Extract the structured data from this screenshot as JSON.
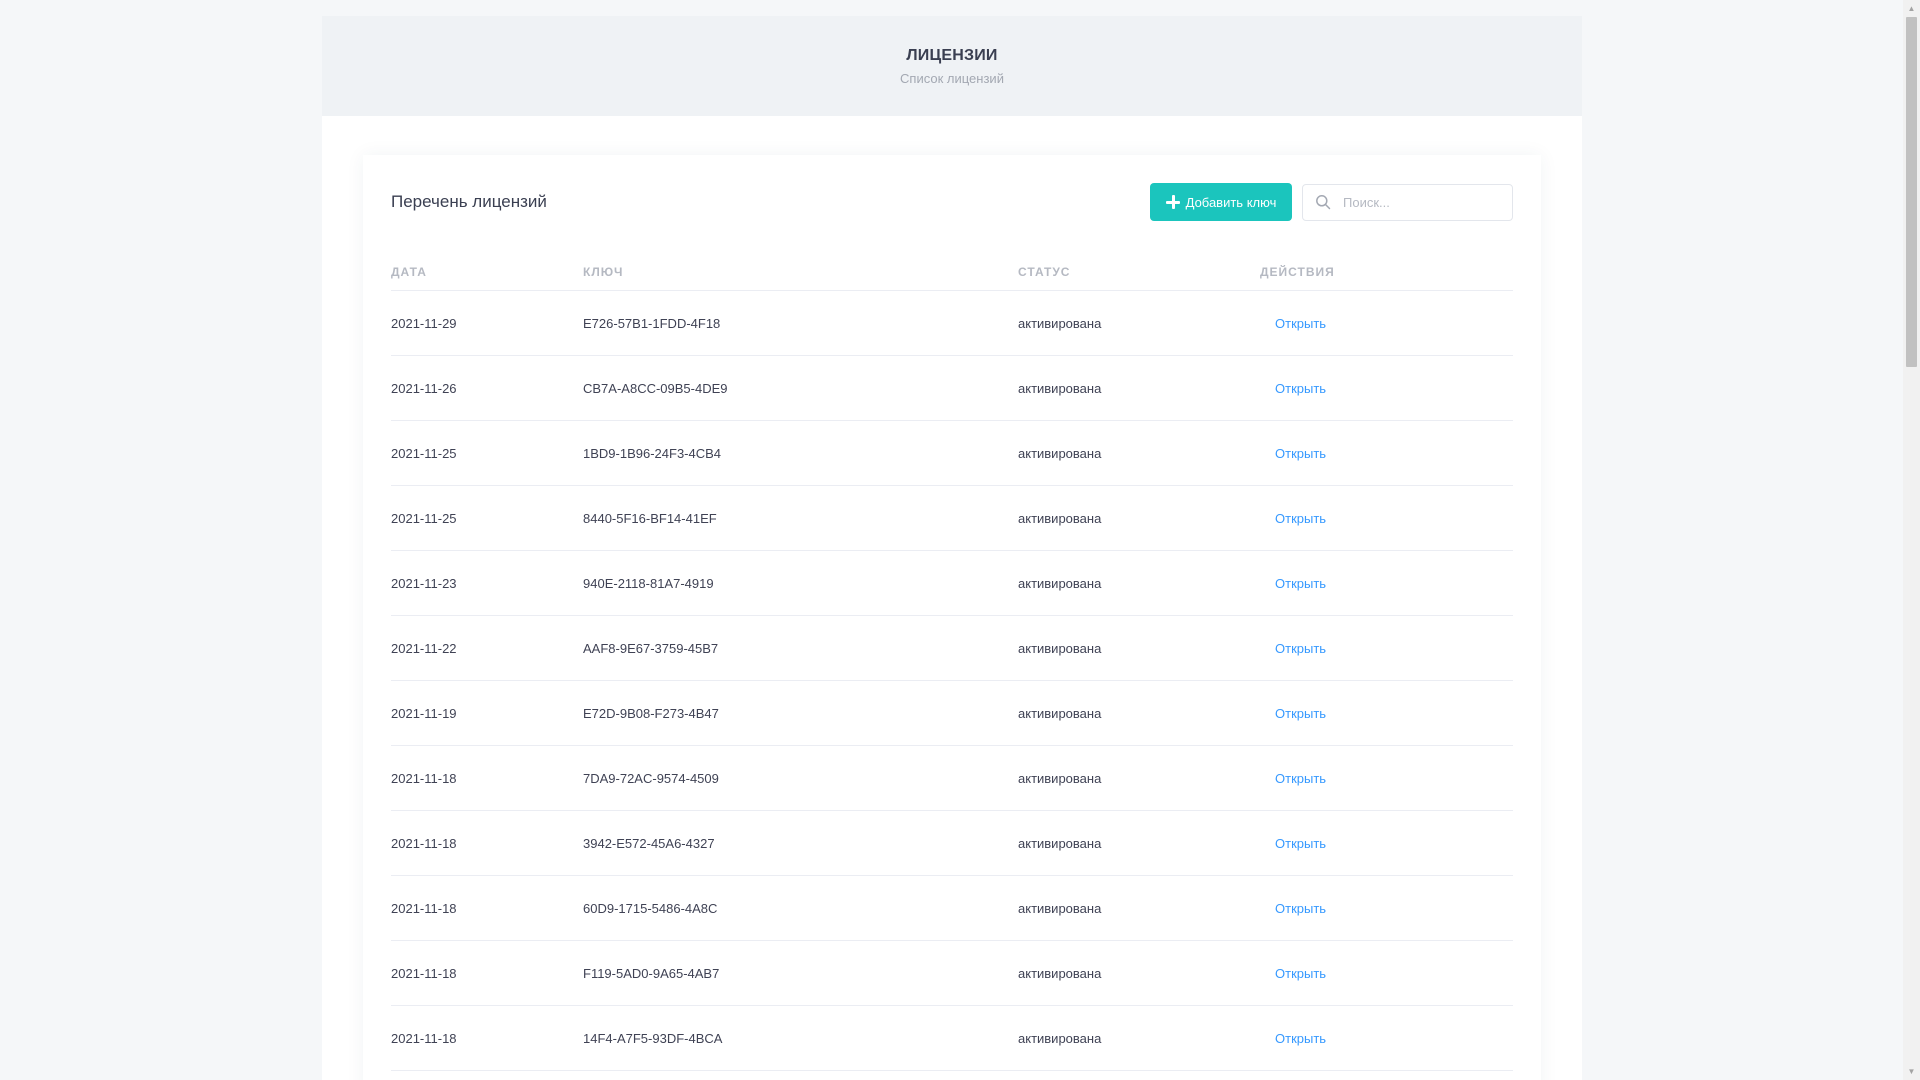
{
  "header": {
    "title": "ЛИЦЕНЗИИ",
    "subtitle": "Список лицензий"
  },
  "card": {
    "title": "Перечень лицензий",
    "add_button_label": "Добавить ключ",
    "search_placeholder": "Поиск..."
  },
  "table": {
    "columns": [
      "ДАТА",
      "КЛЮЧ",
      "СТАТУС",
      "ДЕЙСТВИЯ"
    ],
    "rows": [
      {
        "date": "2021-11-29",
        "key": "E726-57B1-1FDD-4F18",
        "status": "активирована",
        "action": "Открыть"
      },
      {
        "date": "2021-11-26",
        "key": "CB7A-A8CC-09B5-4DE9",
        "status": "активирована",
        "action": "Открыть"
      },
      {
        "date": "2021-11-25",
        "key": "1BD9-1B96-24F3-4CB4",
        "status": "активирована",
        "action": "Открыть"
      },
      {
        "date": "2021-11-25",
        "key": "8440-5F16-BF14-41EF",
        "status": "активирована",
        "action": "Открыть"
      },
      {
        "date": "2021-11-23",
        "key": "940E-2118-81A7-4919",
        "status": "активирована",
        "action": "Открыть"
      },
      {
        "date": "2021-11-22",
        "key": "AAF8-9E67-3759-45B7",
        "status": "активирована",
        "action": "Открыть"
      },
      {
        "date": "2021-11-19",
        "key": "E72D-9B08-F273-4B47",
        "status": "активирована",
        "action": "Открыть"
      },
      {
        "date": "2021-11-18",
        "key": "7DA9-72AC-9574-4509",
        "status": "активирована",
        "action": "Открыть"
      },
      {
        "date": "2021-11-18",
        "key": "3942-E572-45A6-4327",
        "status": "активирована",
        "action": "Открыть"
      },
      {
        "date": "2021-11-18",
        "key": "60D9-1715-5486-4A8C",
        "status": "активирована",
        "action": "Открыть"
      },
      {
        "date": "2021-11-18",
        "key": "F119-5AD0-9A65-4AB7",
        "status": "активирована",
        "action": "Открыть"
      },
      {
        "date": "2021-11-18",
        "key": "14F4-A7F5-93DF-4BCA",
        "status": "активирована",
        "action": "Открыть"
      }
    ]
  },
  "colors": {
    "accent": "#1bc5bd",
    "link": "#3699ff",
    "header_bg": "#eff2f5",
    "page_bg": "#f5f7f9"
  },
  "icons": {
    "add": "plus-icon",
    "search": "search-icon"
  }
}
